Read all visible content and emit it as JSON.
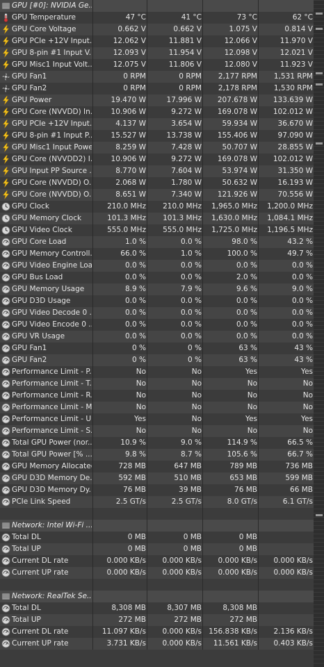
{
  "sections": [
    {
      "title": "GPU [#0]: NVIDIA Ge...",
      "rows": [
        {
          "icon": "thermometer-icon",
          "label": "GPU Temperature",
          "values": [
            "47 °C",
            "41 °C",
            "73 °C",
            "62 °C"
          ]
        },
        {
          "icon": "lightning-icon",
          "label": "GPU Core Voltage",
          "values": [
            "0.662 V",
            "0.662 V",
            "1.075 V",
            "0.814 V"
          ]
        },
        {
          "icon": "lightning-icon",
          "label": "GPU PCIe +12V Input...",
          "values": [
            "12.062 V",
            "11.881 V",
            "12.066 V",
            "11.970 V"
          ]
        },
        {
          "icon": "lightning-icon",
          "label": "GPU 8-pin #1 Input V...",
          "values": [
            "12.093 V",
            "11.954 V",
            "12.098 V",
            "12.021 V"
          ]
        },
        {
          "icon": "lightning-icon",
          "label": "GPU Misc1 Input Volt...",
          "values": [
            "12.075 V",
            "11.806 V",
            "12.080 V",
            "11.923 V"
          ]
        },
        {
          "icon": "fan-icon",
          "label": "GPU Fan1",
          "values": [
            "0 RPM",
            "0 RPM",
            "2,177 RPM",
            "1,531 RPM"
          ]
        },
        {
          "icon": "fan-icon",
          "label": "GPU Fan2",
          "values": [
            "0 RPM",
            "0 RPM",
            "2,178 RPM",
            "1,530 RPM"
          ]
        },
        {
          "icon": "lightning-icon",
          "label": "GPU Power",
          "values": [
            "19.470 W",
            "17.996 W",
            "207.678 W",
            "133.639 W"
          ]
        },
        {
          "icon": "lightning-icon",
          "label": "GPU Core (NVVDD) In...",
          "values": [
            "10.906 W",
            "9.272 W",
            "169.078 W",
            "102.012 W"
          ]
        },
        {
          "icon": "lightning-icon",
          "label": "GPU PCIe +12V Input...",
          "values": [
            "4.137 W",
            "3.654 W",
            "59.934 W",
            "36.670 W"
          ]
        },
        {
          "icon": "lightning-icon",
          "label": "GPU 8-pin #1 Input P...",
          "values": [
            "15.527 W",
            "13.738 W",
            "155.406 W",
            "97.090 W"
          ]
        },
        {
          "icon": "lightning-icon",
          "label": "GPU Misc1 Input Power",
          "values": [
            "8.259 W",
            "7.428 W",
            "50.707 W",
            "28.855 W"
          ]
        },
        {
          "icon": "lightning-icon",
          "label": "GPU Core (NVVDD2) I...",
          "values": [
            "10.906 W",
            "9.272 W",
            "169.078 W",
            "102.012 W"
          ]
        },
        {
          "icon": "lightning-icon",
          "label": "GPU Input PP Source ...",
          "values": [
            "8.770 W",
            "7.604 W",
            "53.974 W",
            "31.350 W"
          ]
        },
        {
          "icon": "lightning-icon",
          "label": "GPU Core (NVVDD) O...",
          "values": [
            "2.068 W",
            "1.780 W",
            "50.632 W",
            "16.193 W"
          ]
        },
        {
          "icon": "lightning-icon",
          "label": "GPU Core (NVVDD) O...",
          "values": [
            "8.651 W",
            "7.340 W",
            "121.926 W",
            "70.556 W"
          ]
        },
        {
          "icon": "clock-icon",
          "label": "GPU Clock",
          "values": [
            "210.0 MHz",
            "210.0 MHz",
            "1,965.0 MHz",
            "1,200.0 MHz"
          ]
        },
        {
          "icon": "clock-icon",
          "label": "GPU Memory Clock",
          "values": [
            "101.3 MHz",
            "101.3 MHz",
            "1,630.0 MHz",
            "1,084.1 MHz"
          ]
        },
        {
          "icon": "clock-icon",
          "label": "GPU Video Clock",
          "values": [
            "555.0 MHz",
            "555.0 MHz",
            "1,725.0 MHz",
            "1,196.5 MHz"
          ]
        },
        {
          "icon": "gauge-icon",
          "label": "GPU Core Load",
          "values": [
            "1.0 %",
            "0.0 %",
            "98.0 %",
            "43.2 %"
          ]
        },
        {
          "icon": "gauge-icon",
          "label": "GPU Memory Controll...",
          "values": [
            "66.0 %",
            "1.0 %",
            "100.0 %",
            "49.7 %"
          ]
        },
        {
          "icon": "gauge-icon",
          "label": "GPU Video Engine Load",
          "values": [
            "0.0 %",
            "0.0 %",
            "0.0 %",
            "0.0 %"
          ]
        },
        {
          "icon": "gauge-icon",
          "label": "GPU Bus Load",
          "values": [
            "0.0 %",
            "0.0 %",
            "2.0 %",
            "0.0 %"
          ]
        },
        {
          "icon": "gauge-icon",
          "label": "GPU Memory Usage",
          "values": [
            "8.9 %",
            "7.9 %",
            "9.6 %",
            "9.0 %"
          ]
        },
        {
          "icon": "gauge-icon",
          "label": "GPU D3D Usage",
          "values": [
            "0.0 %",
            "0.0 %",
            "0.0 %",
            "0.0 %"
          ]
        },
        {
          "icon": "gauge-icon",
          "label": "GPU Video Decode 0 ...",
          "values": [
            "0.0 %",
            "0.0 %",
            "0.0 %",
            "0.0 %"
          ]
        },
        {
          "icon": "gauge-icon",
          "label": "GPU Video Encode 0 ...",
          "values": [
            "0.0 %",
            "0.0 %",
            "0.0 %",
            "0.0 %"
          ]
        },
        {
          "icon": "gauge-icon",
          "label": "GPU VR Usage",
          "values": [
            "0.0 %",
            "0.0 %",
            "0.0 %",
            "0.0 %"
          ]
        },
        {
          "icon": "gauge-icon",
          "label": "GPU Fan1",
          "values": [
            "0 %",
            "0 %",
            "63 %",
            "43 %"
          ]
        },
        {
          "icon": "gauge-icon",
          "label": "GPU Fan2",
          "values": [
            "0 %",
            "0 %",
            "63 %",
            "43 %"
          ]
        },
        {
          "icon": "gauge-icon",
          "label": "Performance Limit - P...",
          "values": [
            "No",
            "No",
            "Yes",
            "Yes"
          ]
        },
        {
          "icon": "gauge-icon",
          "label": "Performance Limit - T...",
          "values": [
            "No",
            "No",
            "No",
            "No"
          ]
        },
        {
          "icon": "gauge-icon",
          "label": "Performance Limit - R...",
          "values": [
            "No",
            "No",
            "No",
            "No"
          ]
        },
        {
          "icon": "gauge-icon",
          "label": "Performance Limit - M...",
          "values": [
            "No",
            "No",
            "No",
            "No"
          ]
        },
        {
          "icon": "gauge-icon",
          "label": "Performance Limit - U...",
          "values": [
            "Yes",
            "No",
            "Yes",
            "Yes"
          ]
        },
        {
          "icon": "gauge-icon",
          "label": "Performance Limit - S...",
          "values": [
            "No",
            "No",
            "No",
            "No"
          ]
        },
        {
          "icon": "gauge-icon",
          "label": "Total GPU Power (nor...",
          "values": [
            "10.9 %",
            "9.0 %",
            "114.9 %",
            "66.5 %"
          ]
        },
        {
          "icon": "gauge-icon",
          "label": "Total GPU Power [% ...",
          "values": [
            "9.8 %",
            "8.7 %",
            "105.6 %",
            "66.7 %"
          ]
        },
        {
          "icon": "gauge-icon",
          "label": "GPU Memory Allocated",
          "values": [
            "728 MB",
            "647 MB",
            "789 MB",
            "736 MB"
          ]
        },
        {
          "icon": "gauge-icon",
          "label": "GPU D3D Memory De...",
          "values": [
            "592 MB",
            "510 MB",
            "653 MB",
            "599 MB"
          ]
        },
        {
          "icon": "gauge-icon",
          "label": "GPU D3D Memory Dy...",
          "values": [
            "76 MB",
            "39 MB",
            "76 MB",
            "66 MB"
          ]
        },
        {
          "icon": "gauge-icon",
          "label": "PCIe Link Speed",
          "values": [
            "2.5 GT/s",
            "2.5 GT/s",
            "8.0 GT/s",
            "6.1 GT/s"
          ]
        }
      ]
    },
    {
      "title": "Network: Intel Wi-Fi ...",
      "rows": [
        {
          "icon": "gauge-icon",
          "label": "Total DL",
          "values": [
            "0 MB",
            "0 MB",
            "0 MB",
            ""
          ]
        },
        {
          "icon": "gauge-icon",
          "label": "Total UP",
          "values": [
            "0 MB",
            "0 MB",
            "0 MB",
            ""
          ]
        },
        {
          "icon": "gauge-icon",
          "label": "Current DL rate",
          "values": [
            "0.000 KB/s",
            "0.000 KB/s",
            "0.000 KB/s",
            "0.000 KB/s"
          ]
        },
        {
          "icon": "gauge-icon",
          "label": "Current UP rate",
          "values": [
            "0.000 KB/s",
            "0.000 KB/s",
            "0.000 KB/s",
            "0.000 KB/s"
          ]
        }
      ]
    },
    {
      "title": "Network: RealTek Se...",
      "rows": [
        {
          "icon": "gauge-icon",
          "label": "Total DL",
          "values": [
            "8,308 MB",
            "8,307 MB",
            "8,308 MB",
            ""
          ]
        },
        {
          "icon": "gauge-icon",
          "label": "Total UP",
          "values": [
            "272 MB",
            "272 MB",
            "272 MB",
            ""
          ]
        },
        {
          "icon": "gauge-icon",
          "label": "Current DL rate",
          "values": [
            "11.097 KB/s",
            "0.000 KB/s",
            "156.838 KB/s",
            "2.136 KB/s"
          ]
        },
        {
          "icon": "gauge-icon",
          "label": "Current UP rate",
          "values": [
            "3.731 KB/s",
            "0.000 KB/s",
            "11.561 KB/s",
            "0.403 KB/s"
          ]
        }
      ]
    }
  ],
  "colors": {
    "background": "#3c3c3c",
    "row_alt": "#454545",
    "text": "#e6e6e6",
    "lightning": "#f2c21a",
    "thermometer": "#d23a3a"
  }
}
